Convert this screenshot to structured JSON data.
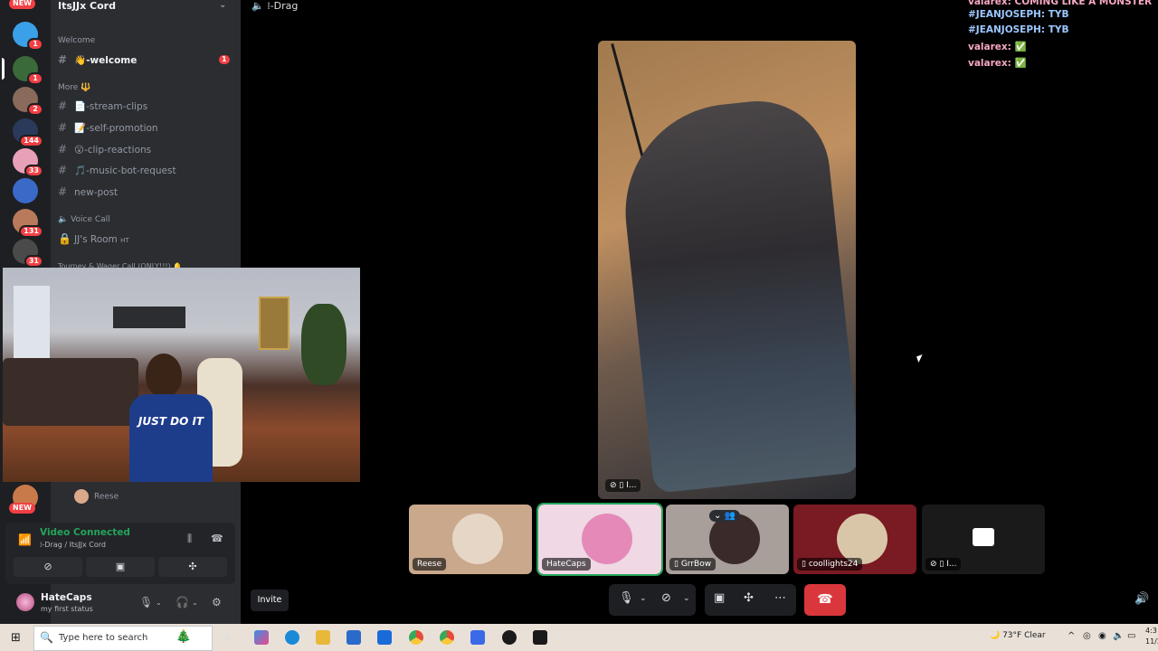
{
  "guilds": {
    "new_badge_top": "NEW",
    "new_badge_bottom": "NEW",
    "items": [
      {
        "badge": "1"
      },
      {
        "badge": "1"
      },
      {
        "badge": "2"
      },
      {
        "badge": "144"
      },
      {
        "badge": "33"
      },
      {
        "badge": ""
      },
      {
        "badge": "131"
      },
      {
        "badge": "31"
      }
    ]
  },
  "server": {
    "name": "ItsJJx Cord"
  },
  "categories": {
    "welcome": "Welcome",
    "more": "More 🔱",
    "voice": "🔈 Voice Call",
    "tourney": "Tourney & Wager Call (ONLY!!!) 🔔"
  },
  "channels": [
    {
      "name": "👋-welcome",
      "unread": "1"
    },
    {
      "name": "📄-stream-clips"
    },
    {
      "name": "📝-self-promotion"
    },
    {
      "name": "😮-clip-reactions"
    },
    {
      "name": "🎵-music-bot-request"
    },
    {
      "name": "new-post"
    }
  ],
  "voice_channel": {
    "name": "JJ's Room",
    "tag": "HT"
  },
  "stream_pip": {
    "shirt_text": "JUST DO IT"
  },
  "member_row": {
    "name": "Reese"
  },
  "voice_panel": {
    "status": "Video Connected",
    "location": "⁞-Drag / ItsJJx Cord"
  },
  "user": {
    "name": "HateCaps",
    "status": "my first status"
  },
  "call": {
    "title": "⁞-Drag"
  },
  "main_video": {
    "tag": "I..."
  },
  "chat": [
    {
      "text": "valarex: COMING LIKE A MONSTER",
      "color": "#f7a8c4"
    },
    {
      "text": "#JEANJOSEPH: TYB",
      "color": "#9cc7ff"
    },
    {
      "text": "#JEANJOSEPH: TYB",
      "color": "#9cc7ff"
    },
    {
      "text": "valarex: ✅",
      "color": "#f7a8c4"
    },
    {
      "text": "valarex: ✅",
      "color": "#f7a8c4"
    }
  ],
  "tiles": [
    {
      "label": "Reese"
    },
    {
      "label": "HateCaps"
    },
    {
      "label": "GrrBow"
    },
    {
      "label": "coollights24"
    },
    {
      "label": "I..."
    }
  ],
  "controls": {
    "invite": "Invite"
  },
  "taskbar": {
    "search_placeholder": "Type here to search",
    "weather": "73°F  Clear",
    "time": "4:3",
    "date": "11/2"
  }
}
